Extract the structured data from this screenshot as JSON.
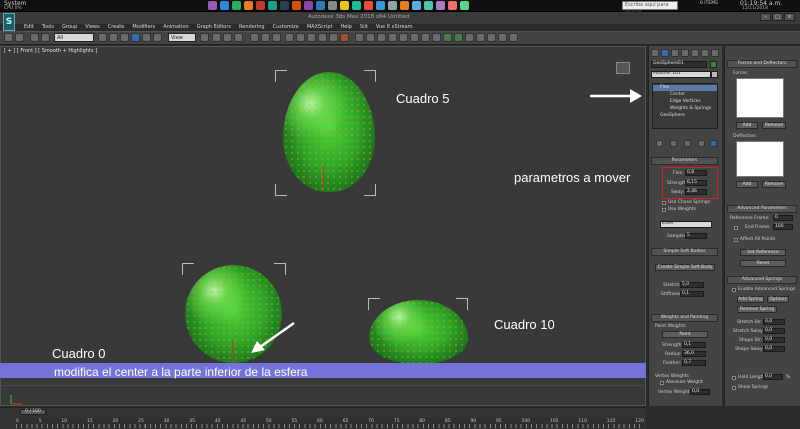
{
  "taskbar": {
    "system_label": "System",
    "system_sub": "CPU 0%",
    "search_placeholder": "Escribe aquí para buscar",
    "time": "01:19:54 a.m.",
    "date": "12/11/2018",
    "items": "0 ITEMS"
  },
  "window": {
    "title": "Autodesk 3ds Max 2018 x64     Untitled",
    "logo": "S",
    "menus": [
      "Edit",
      "Tools",
      "Group",
      "Views",
      "Create",
      "Modifiers",
      "Animation",
      "Graph Editors",
      "Rendering",
      "Customize",
      "MAXScript",
      "Help",
      "Siit",
      "Vue 8 xStream"
    ]
  },
  "toolbar": {
    "selection_filter": "All",
    "coord_system": "View"
  },
  "viewport": {
    "label": "[ + ] [ Front ] [ Smooth + Highlights ]"
  },
  "annotations": {
    "cuadro5": "Cuadro 5",
    "cuadro10": "Cuadro 10",
    "cuadro0": "Cuadro 0",
    "parametros": "parametros a mover",
    "banner": "modifica el center a la parte inferior de la esfera"
  },
  "command_panel": {
    "object_name": "GeoSphere01",
    "modifier_list": "Modifier List",
    "stack": [
      "Flex",
      "Center",
      "Edge Vertices",
      "Weights & Springs",
      "GeoSphere"
    ],
    "parameters_title": "Parameters",
    "flex_label": "Flex:",
    "flex_value": "0,8",
    "strength_label": "Strength:",
    "strength_value": "6,15",
    "sway_label": "Sway:",
    "sway_value": "2,46",
    "chase_springs": "Use Chase Springs",
    "use_weights": "Use Weights",
    "solver": "Euler",
    "samples_label": "Samples:",
    "samples_value": "5",
    "soft_bodies_title": "Simple Soft Bodies",
    "create_soft_body": "Create Simple Soft Body",
    "stretch_label": "Stretch:",
    "stretch_value": "5,0",
    "stiffness_label": "Stiffness:",
    "stiffness_value": "0,1",
    "weights_title": "Weights and Painting",
    "paint_weights": "Paint Weights",
    "paint_btn": "Paint",
    "wp_strength_label": "Strength:",
    "wp_strength_value": "0,1",
    "radius_label": "Radius:",
    "radius_value": "36,0",
    "feather_label": "Feather:",
    "feather_value": "0,7",
    "vertex_weights": "Vertex Weights",
    "absolute_weight": "Absolute Weight",
    "vertex_weight_label": "Vertex Weight:",
    "vertex_weight_value": "0,0"
  },
  "right_panel": {
    "forces_title": "Forces and Deflectors",
    "forces_label": "Forces",
    "add": "Add",
    "remove": "Remove",
    "deflectors_label": "Deflectors",
    "advanced_title": "Advanced Parameters",
    "reference_frame_label": "Reference Frame:",
    "reference_frame_value": "0",
    "end_frame_label": "End Frame:",
    "end_frame_value": "100",
    "affect_all": "Affect All Points",
    "set_reference": "Set Reference",
    "reset": "Reset",
    "adv_springs_title": "Advanced Springs",
    "enable_adv": "Enable Advanced Springs",
    "add_spring": "Add Spring",
    "options": "Options",
    "remove_spring": "Remove Spring",
    "stretch_str_label": "Stretch Str:",
    "stretch_str_value": "0,0",
    "stretch_sway_label": "Stretch Sway:",
    "stretch_sway_value": "0,0",
    "shape_str_label": "Shape Str:",
    "shape_str_value": "0,0",
    "shape_sway_label": "Shape Sway:",
    "shape_sway_value": "0,0",
    "hold_length": "Hold Length",
    "hold_length_value": "0,0",
    "percent": "%",
    "show_springs": "Show Springs"
  },
  "timeline": {
    "slider": "0 / 100",
    "ticks": [
      "0",
      "5",
      "10",
      "15",
      "20",
      "25",
      "30",
      "35",
      "40",
      "45",
      "50",
      "55",
      "60",
      "65",
      "70",
      "75",
      "80",
      "85",
      "90",
      "95",
      "100",
      "105",
      "110",
      "115",
      "120"
    ]
  },
  "colors": {
    "banner": "#7373d9",
    "highlight": "#d62020",
    "sphere": "#36b830"
  }
}
